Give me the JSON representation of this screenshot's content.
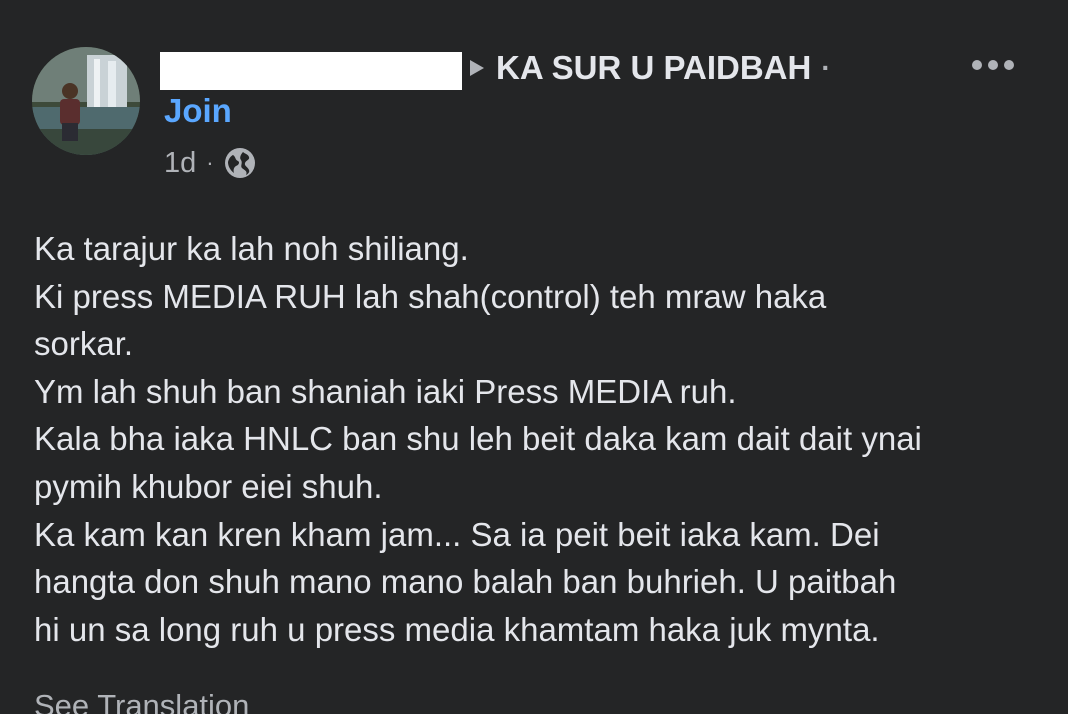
{
  "post": {
    "group_name": "KA SUR U PAIDBAH",
    "header_dot": "·",
    "join_label": "Join",
    "timestamp": "1d",
    "meta_dot": "·",
    "privacy_icon": "globe-icon",
    "more_icon": "more-options-icon",
    "lines": [
      "Ka tarajur ka lah noh shiliang.",
      "Ki press MEDIA RUH lah shah(control) teh mraw haka",
      "sorkar.",
      "Ym lah shuh ban shaniah iaki Press MEDIA ruh.",
      "Kala bha iaka HNLC ban shu leh beit daka kam dait dait ynai",
      "pymih khubor eiei shuh.",
      "Ka kam kan kren kham jam... Sa ia peit beit iaka kam. Dei",
      "hangta don shuh mano mano balah ban buhrieh. U paitbah",
      "hi un sa long ruh u press media khamtam haka juk mynta."
    ],
    "see_translation": "See Translation"
  },
  "colors": {
    "background": "#242526",
    "primary_text": "#e4e6eb",
    "secondary_text": "#b0b3b8",
    "link": "#5aa7ff"
  }
}
